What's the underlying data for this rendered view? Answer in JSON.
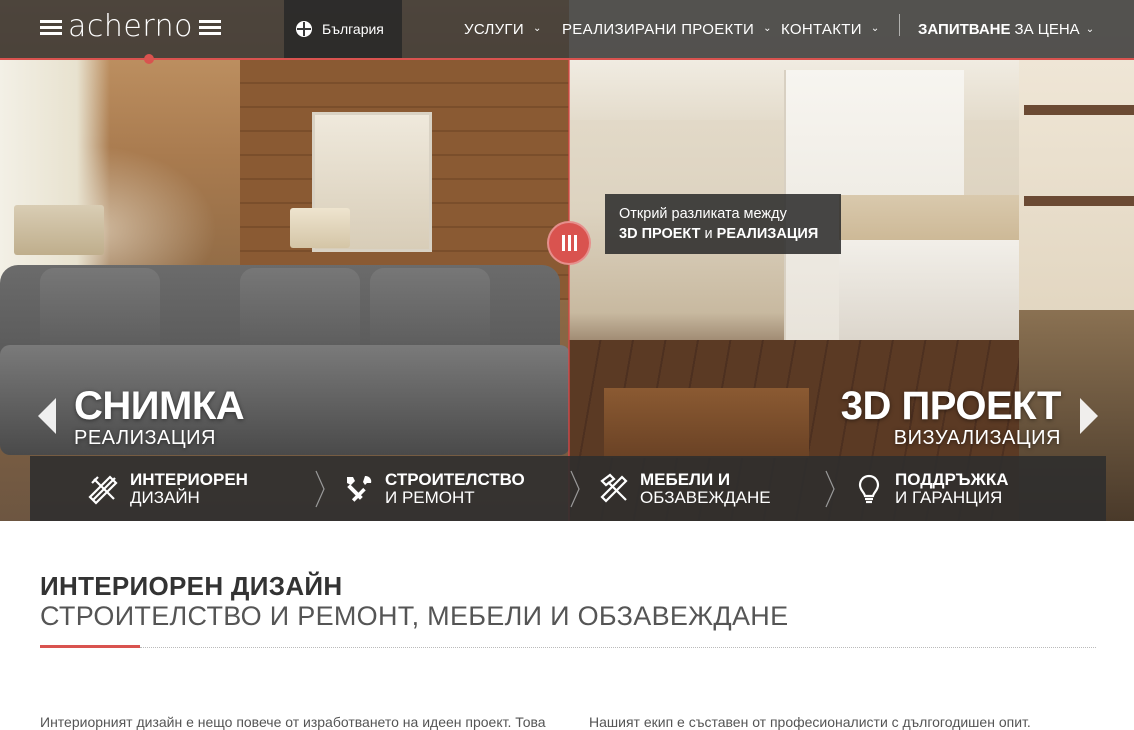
{
  "header": {
    "logo_text": "acherno",
    "country": "България",
    "nav": [
      {
        "label": "УСЛУГИ"
      },
      {
        "label": "РЕАЛИЗИРАНИ ПРОЕКТИ"
      },
      {
        "label": "КОНТАКТИ"
      }
    ],
    "cta_bold": "ЗАПИТВАНЕ",
    "cta_rest": "ЗА ЦЕНА"
  },
  "hero": {
    "tooltip_line1": "Открий разликата между",
    "tooltip_bold1": "3D ПРОЕКТ",
    "tooltip_mid": " и ",
    "tooltip_bold2": "РЕАЛИЗАЦИЯ",
    "left_big": "СНИМКА",
    "left_small": "РЕАЛИЗАЦИЯ",
    "right_big": "3D ПРОЕКТ",
    "right_small": "ВИЗУАЛИЗАЦИЯ",
    "accent_color": "#d9534f"
  },
  "services": [
    {
      "line1": "ИНТЕРИОРЕН",
      "line2": "ДИЗАЙН",
      "icon": "pencil-ruler-icon"
    },
    {
      "line1": "СТРОИТЕЛСТВО",
      "line2": "И РЕМОНТ",
      "icon": "tools-icon"
    },
    {
      "line1": "МЕБЕЛИ И",
      "line2": "ОБЗАВЕЖДАНЕ",
      "icon": "hammer-saw-icon"
    },
    {
      "line1": "ПОДДРЪЖКА",
      "line2": "И ГАРАНЦИЯ",
      "icon": "lightbulb-icon"
    }
  ],
  "content": {
    "title": "ИНТЕРИОРЕН ДИЗАЙН",
    "subtitle": "СТРОИТЕЛСТВО И РЕМОНТ, МЕБЕЛИ И ОБЗАВЕЖДАНЕ",
    "para_left": "Интериорният дизайн е нещо повече от изработването на идеен проект. Това",
    "para_right": "Нашият екип е съставен от професионалисти с дългогодишен опит."
  }
}
